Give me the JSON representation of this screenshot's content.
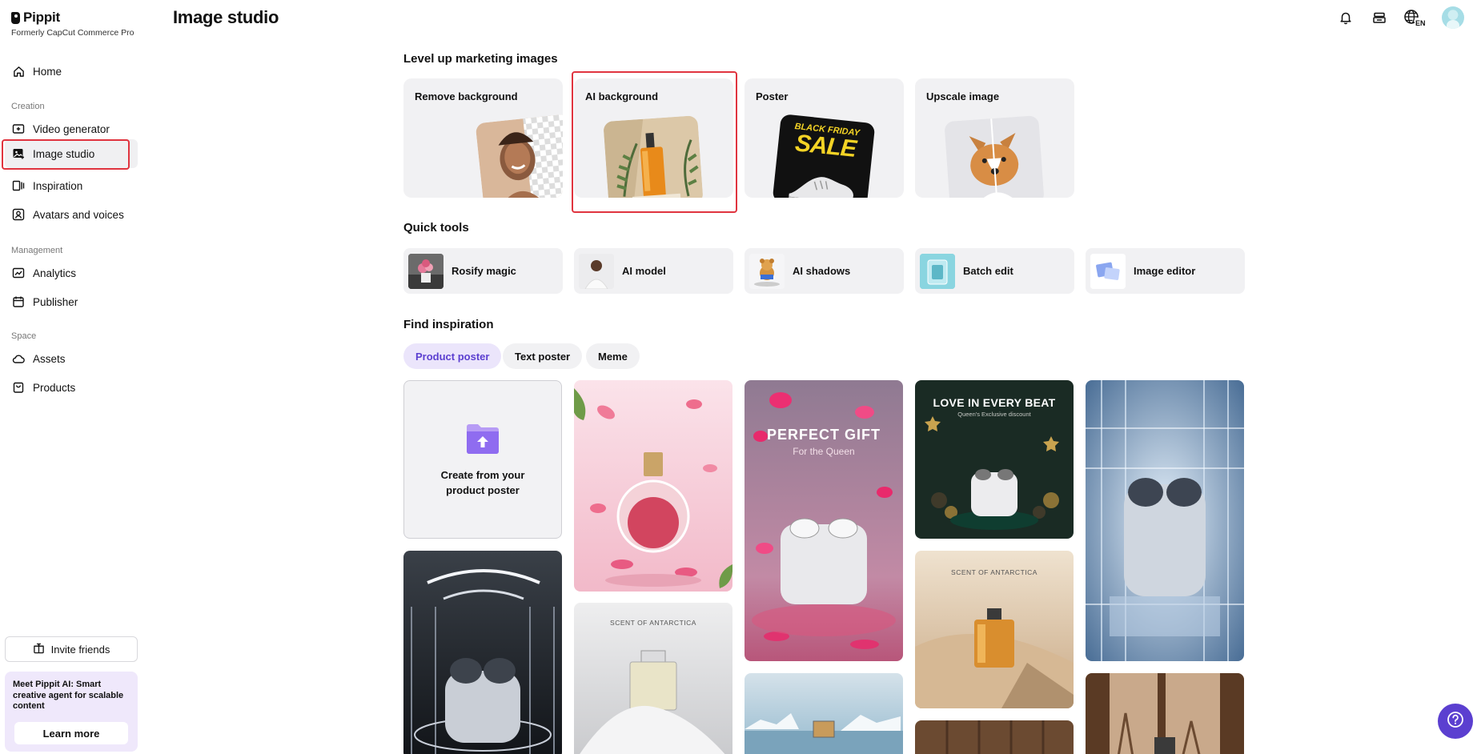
{
  "brand": {
    "name": "Pippit",
    "subtitle": "Formerly CapCut Commerce Pro"
  },
  "sidebar": {
    "home": "Home",
    "sections": {
      "creation": "Creation",
      "management": "Management",
      "space": "Space"
    },
    "items": {
      "video_generator": "Video generator",
      "image_studio": "Image studio",
      "inspiration": "Inspiration",
      "avatars_voices": "Avatars and voices",
      "analytics": "Analytics",
      "publisher": "Publisher",
      "assets": "Assets",
      "products": "Products"
    },
    "invite": "Invite friends",
    "promo": {
      "text": "Meet Pippit AI: Smart creative agent for scalable content",
      "button": "Learn more"
    }
  },
  "header": {
    "title": "Image studio",
    "language": "EN"
  },
  "marketing": {
    "title": "Level up marketing images",
    "cards": [
      "Remove background",
      "AI background",
      "Poster",
      "Upscale image"
    ]
  },
  "poster_thumb": {
    "line1": "BLACK FRIDAY",
    "line2": "SALE"
  },
  "quick_tools": {
    "title": "Quick tools",
    "items": [
      "Rosify magic",
      "AI model",
      "AI shadows",
      "Batch edit",
      "Image editor"
    ]
  },
  "inspiration": {
    "title": "Find inspiration",
    "chips": [
      "Product poster",
      "Text poster",
      "Meme"
    ],
    "upload": {
      "line1": "Create from your",
      "line2": "product poster"
    },
    "posters": {
      "gift_title": "PERFECT GIFT",
      "gift_sub": "For the Queen",
      "love_title": "LOVE IN EVERY BEAT",
      "love_sub": "Queen's Exclusive discount",
      "scent": "SCENT OF ANTARCTICA"
    }
  },
  "colors": {
    "accent": "#5b3fd0",
    "highlight": "#e0343f",
    "card_bg": "#f1f1f3"
  }
}
